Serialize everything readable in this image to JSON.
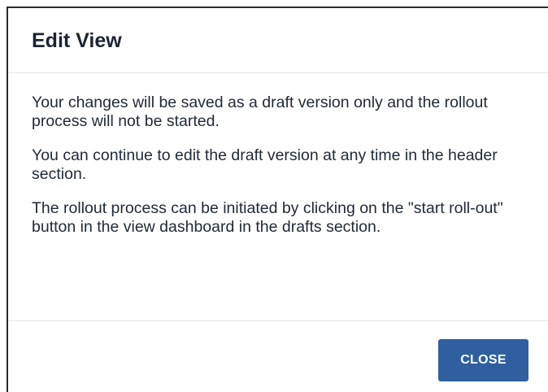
{
  "dialog": {
    "title": "Edit View",
    "paragraphs": [
      "Your changes will be saved as a draft version only and the rollout process will not be started.",
      "You can continue to edit the draft version at any time in the header section.",
      "The rollout process can be initiated by clicking on the \"start roll-out\" button in the view dashboard in the drafts section."
    ],
    "close_label": "CLOSE"
  },
  "colors": {
    "primary_button": "#2f5f9f",
    "title_text": "#1b2433",
    "body_text": "#1f2937",
    "divider": "#e3e6ea"
  }
}
